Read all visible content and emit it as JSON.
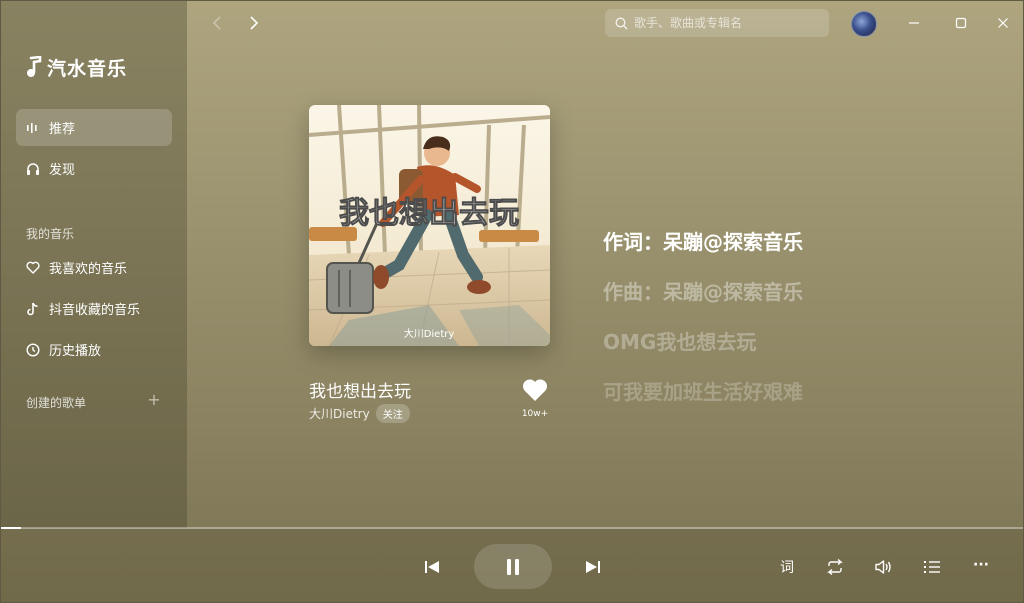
{
  "app": {
    "name": "汽水音乐"
  },
  "sidebar": {
    "nav": [
      {
        "label": "推荐",
        "icon": "bars-icon",
        "active": true
      },
      {
        "label": "发现",
        "icon": "headphones-icon",
        "active": false
      }
    ],
    "my_music_label": "我的音乐",
    "my_music": [
      {
        "label": "我喜欢的音乐",
        "icon": "heart-icon"
      },
      {
        "label": "抖音收藏的音乐",
        "icon": "tiktok-icon"
      },
      {
        "label": "历史播放",
        "icon": "clock-icon"
      }
    ],
    "created_playlists_label": "创建的歌单"
  },
  "topbar": {
    "search_placeholder": "歌手、歌曲或专辑名"
  },
  "now_playing": {
    "cover_text": "我也想出去玩",
    "cover_signature": "大川Dietry",
    "title": "我也想出去玩",
    "artist": "大川Dietry",
    "follow_label": "关注",
    "like_count": "10w+",
    "progress": 0.02
  },
  "lyrics": [
    "作词：呆蹦@探索音乐",
    "作曲：呆蹦@探索音乐",
    "OMG我也想去玩",
    "可我要加班生活好艰难"
  ],
  "player": {
    "lyrics_toggle_label": "词",
    "more_label": "···"
  },
  "colors": {
    "background_top": "#aea57f",
    "background_bottom": "#7a7352",
    "text_primary": "#ffffff"
  }
}
